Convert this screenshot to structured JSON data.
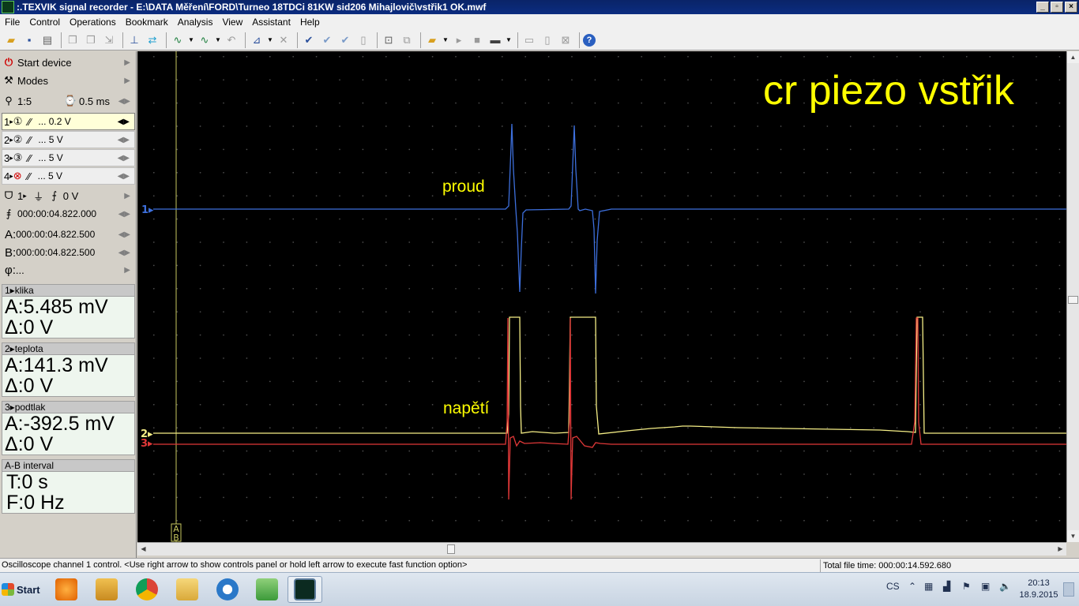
{
  "window": {
    "title": ":.TEXVIK  signal recorder - E:\\DATA Měření\\FORD\\Turneo 18TDCi 81KW sid206 Mihajlovič\\vstřik1 OK.mwf",
    "min_btn": "_",
    "max_btn": "▫",
    "close_btn": "×"
  },
  "menu": [
    "File",
    "Control",
    "Operations",
    "Bookmark",
    "Analysis",
    "View",
    "Assistant",
    "Help"
  ],
  "toolbar_icons": [
    "open-folder-icon",
    "save-icon",
    "print-icon",
    "copy-icon",
    "paste-icon",
    "export-icon",
    "cursor-icon",
    "zoom-icon",
    "wave-icon",
    "wave2-icon",
    "undo-icon",
    "measure-icon",
    "mark-icon",
    "check-icon",
    "check2-icon",
    "check3-icon",
    "page-icon",
    "zoom-fit-icon",
    "compare-icon",
    "folder-open-icon",
    "play-icon",
    "stop-icon",
    "record-icon",
    "screen-icon",
    "image-icon",
    "page2-icon",
    "delete-icon",
    "help-icon"
  ],
  "left_panel": {
    "start_device": "Start device",
    "modes": "Modes",
    "zoom": "1:5",
    "timebase": "0.5 ms",
    "channels": [
      {
        "num": "1",
        "badge": "①",
        "scale": "... 0.2 V"
      },
      {
        "num": "2",
        "badge": "②",
        "scale": "... 5 V"
      },
      {
        "num": "3",
        "badge": "③",
        "scale": "... 5 V"
      },
      {
        "num": "4",
        "badge": "⊗",
        "scale": "... 5 V"
      }
    ],
    "trigger_channel": "1",
    "trigger_level": "0 V",
    "trigger_time": "000:00:04.822.000",
    "cursor_a_label": "A:",
    "cursor_a": "000:00:04.822.500",
    "cursor_b_label": "B:",
    "cursor_b": "000:00:04.822.500",
    "phi_label": "φ:",
    "phi": "..."
  },
  "measurements": [
    {
      "header": "1▸klika",
      "a": "A:5.485 mV",
      "d": "Δ:0 V"
    },
    {
      "header": "2▸teplota",
      "a": "A:141.3 mV",
      "d": "Δ:0 V"
    },
    {
      "header": "3▸podtlak",
      "a": "A:-392.5 mV",
      "d": "Δ:0 V"
    }
  ],
  "ab_interval": {
    "header": "A-B interval",
    "t": "T:0 s",
    "f": "F:0 Hz"
  },
  "scope": {
    "title": "cr piezo vstřik",
    "label_current": "proud",
    "label_voltage": "napětí",
    "ch1_marker": "1▸",
    "ch2_marker": "2▸",
    "ch3_marker": "3▸",
    "cursor_label_a": "A",
    "cursor_label_b": "B",
    "colors": {
      "bg": "#000000",
      "grid": "#3a3a3a",
      "ch1": "#3d6fdc",
      "ch2": "#f5ee86",
      "ch3": "#e03838",
      "annot": "#ffff00"
    }
  },
  "status": {
    "message": "Oscilloscope channel 1 control. <Use right arrow to show controls panel or hold left arrow to execute fast function option>",
    "total_time": "Total file time: 000:00:14.592.680"
  },
  "taskbar": {
    "start": "Start",
    "lang": "CS",
    "time": "20:13",
    "date": "18.9.2015"
  }
}
